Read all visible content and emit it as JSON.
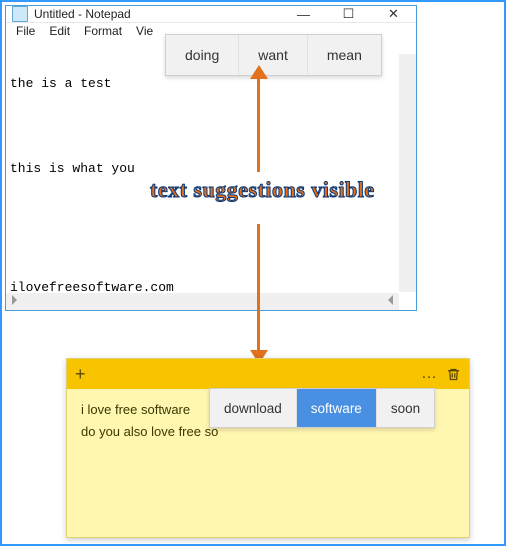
{
  "notepad": {
    "title": "Untitled - Notepad",
    "menu": {
      "file": "File",
      "edit": "Edit",
      "format": "Format",
      "view": "Vie"
    },
    "lines": {
      "l1": "the is a test",
      "l2": "",
      "l3": "this is what you",
      "l4": "",
      "l5": "",
      "l6": "ilovefreesoftware.com"
    },
    "win": {
      "min": "—",
      "max": "☐",
      "close": "✕"
    }
  },
  "suggest_top": {
    "a": "doing",
    "b": "want",
    "c": "mean"
  },
  "annotation": {
    "label": "text suggestions visible"
  },
  "sticky": {
    "plus": "+",
    "dots": "…",
    "lines": {
      "l1": "i love free software",
      "l2": "do you also love free so"
    }
  },
  "suggest_bot": {
    "a": "download",
    "b": "software",
    "c": "soon"
  }
}
